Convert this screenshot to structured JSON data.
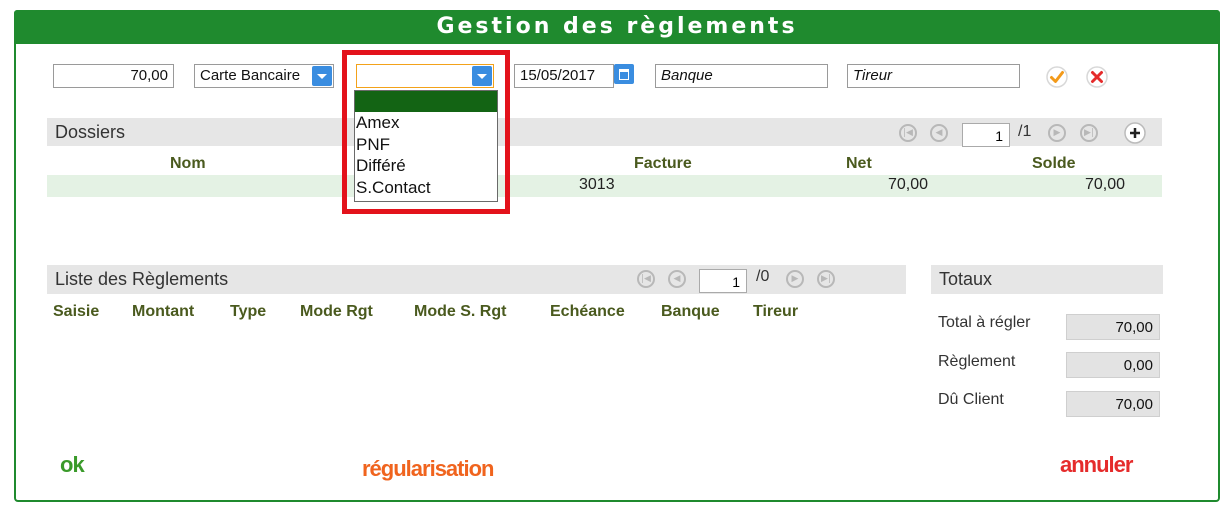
{
  "window": {
    "title": "Gestion des règlements"
  },
  "form": {
    "amount": "70,00",
    "payment_type": "Carte Bancaire",
    "payment_subtype": "",
    "date": "15/05/2017",
    "bank_placeholder": "Banque",
    "drawer_placeholder": "Tireur",
    "dropdown_options": [
      "",
      "Amex",
      "PNF",
      "Différé",
      "S.Contact"
    ]
  },
  "dossiers": {
    "title": "Dossiers",
    "pager": {
      "current": "1",
      "total": "/1"
    },
    "columns": [
      "Nom",
      "Facture",
      "Net",
      "Solde"
    ],
    "rows": [
      {
        "facture": "3013",
        "net": "70,00",
        "solde": "70,00"
      }
    ]
  },
  "reglements": {
    "title": "Liste des Règlements",
    "pager": {
      "current": "1",
      "total": "/0"
    },
    "columns": [
      "Saisie",
      "Montant",
      "Type",
      "Mode Rgt",
      "Mode S. Rgt",
      "Echéance",
      "Banque",
      "Tireur"
    ]
  },
  "totaux": {
    "title": "Totaux",
    "items": [
      {
        "label": "Total à régler",
        "value": "70,00"
      },
      {
        "label": "Règlement",
        "value": "0,00"
      },
      {
        "label": "Dû Client",
        "value": "70,00"
      }
    ]
  },
  "actions": {
    "ok": "ok",
    "regularisation": "régularisation",
    "annuler": "annuler"
  },
  "colors": {
    "brand_green": "#1f8a2e",
    "highlight_red": "#e3121b",
    "accent_blue": "#3a8de0",
    "ok_green": "#3a9a2a",
    "orange": "#f0641e",
    "red": "#e52b2b"
  },
  "icons": {
    "confirm": "check-circle-icon",
    "cancel": "x-circle-icon",
    "add": "plus-circle-icon",
    "calendar": "calendar-icon"
  }
}
